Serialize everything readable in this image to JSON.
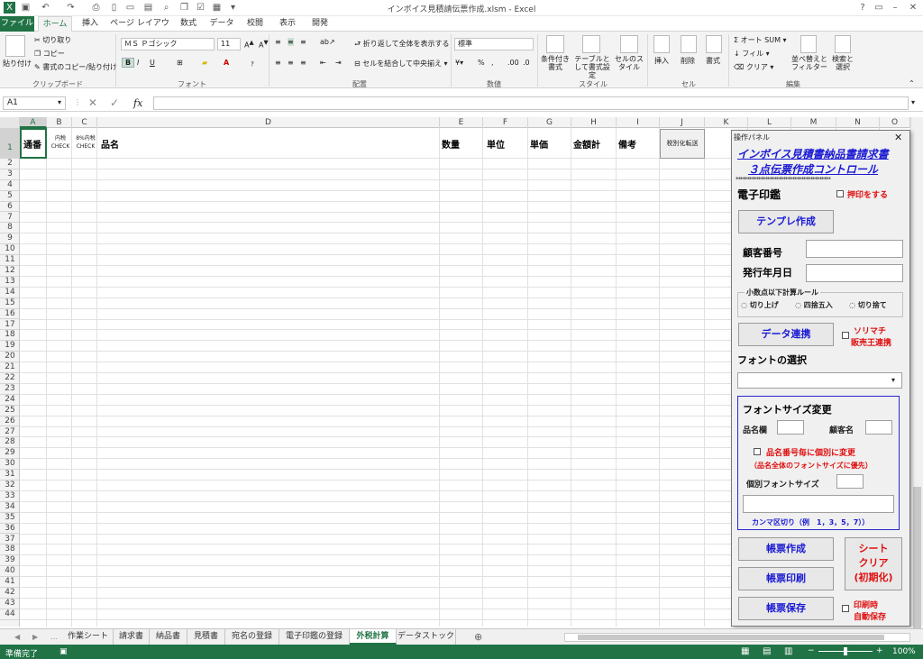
{
  "window": {
    "title": "インボイス見積請伝票作成.xlsm - Excel"
  },
  "tabs": [
    "ファイル",
    "ホーム",
    "挿入",
    "ページ レイアウト",
    "数式",
    "データ",
    "校閲",
    "表示",
    "開発"
  ],
  "ribbon": {
    "paste": "貼り付け",
    "cut": "切り取り",
    "copy": "コピー",
    "format_painter": "書式のコピー/貼り付け",
    "clipboard": "クリップボード",
    "font_name": "ＭＳ Ｐゴシック",
    "font_size": "11",
    "font": "フォント",
    "wrap": "折り返して全体を表示する",
    "merge": "セルを結合して中央揃え",
    "alignment": "配置",
    "number_format": "標準",
    "number": "数値",
    "cond_format": "条件付き書式",
    "table_format": "テーブルとして書式設定",
    "cell_style": "セルのスタイル",
    "styles": "スタイル",
    "insert": "挿入",
    "delete": "削除",
    "format": "書式",
    "cells": "セル",
    "autosum": "オート SUM",
    "fill": "フィル",
    "clear": "クリア",
    "sort": "並べ替えとフィルター",
    "find": "検索と選択",
    "editing": "編集"
  },
  "formula_bar": {
    "name_box": "A1",
    "fx": "fx"
  },
  "columns": [
    "A",
    "B",
    "C",
    "D",
    "E",
    "F",
    "G",
    "H",
    "I",
    "J",
    "K",
    "L",
    "M",
    "N",
    "O"
  ],
  "header_row": {
    "a": "通番",
    "b": "内税CHECK",
    "c": "8%内税CHECK",
    "d": "品名",
    "e": "数量",
    "f": "単位",
    "g": "単価",
    "h": "金額計",
    "i": "備考",
    "j": "税別化転送"
  },
  "sheet_tabs": [
    "作業シート",
    "請求書",
    "納品書",
    "見積書",
    "宛名の登録",
    "電子印鑑の登録",
    "外税計算",
    "データストック"
  ],
  "status": {
    "ready": "準備完了",
    "zoom": "100%"
  },
  "panel": {
    "title": "操作パネル",
    "heading1": "インボイス見積書納品書請求書",
    "heading2": "３点伝票作成コントロール",
    "stars": "******************************************",
    "seal_label": "電子印鑑",
    "stamp_check": "押印をする",
    "template_btn": "テンプレ作成",
    "customer_no": "顧客番号",
    "issue_date": "発行年月日",
    "rounding_title": "小数点以下計算ルール",
    "round_up": "切り上げ",
    "round_half": "四捨五入",
    "round_down": "切り捨て",
    "data_btn": "データ連携",
    "sorimachi": "ソリマチ",
    "sorimachi2": "販売王連携",
    "font_select": "フォントの選択",
    "font_size_title": "フォントサイズ変更",
    "item_col": "品名欄",
    "customer_name": "顧客名",
    "per_item": "品名番号毎に個別に変更",
    "per_item_note": "（品名全体のフォントサイズに優先）",
    "indiv_size": "個別フォントサイズ",
    "comma_note": "カンマ区切り（例　1，3，5，7））",
    "create_btn": "帳票作成",
    "print_btn": "帳票印刷",
    "save_btn": "帳票保存",
    "clear1": "シート",
    "clear2": "クリア",
    "clear3": "(初期化)",
    "autosave1": "印刷時",
    "autosave2": "自動保存"
  }
}
